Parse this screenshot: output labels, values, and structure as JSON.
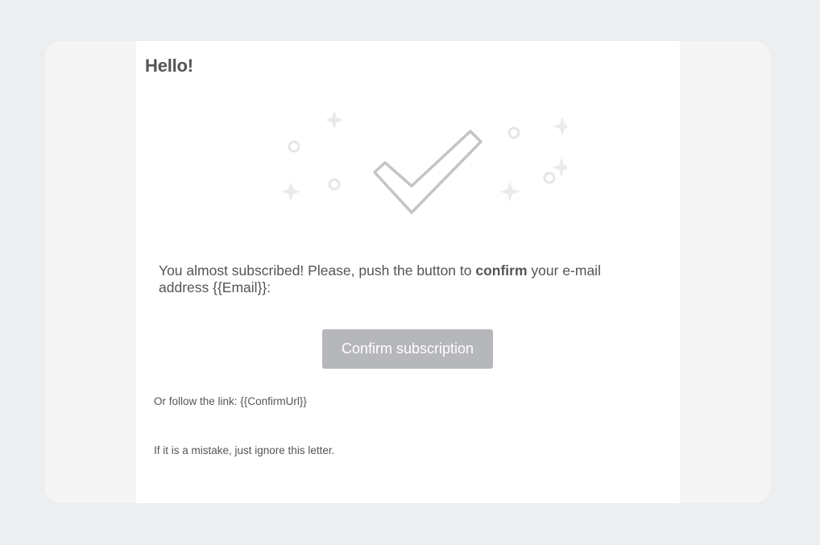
{
  "email": {
    "greeting": "Hello!",
    "message_before": "You almost subscribed! Please, push the button to ",
    "message_bold": "confirm",
    "message_after": " your e-mail address {{Email}}:",
    "confirm_button_label": "Confirm subscription",
    "link_prefix": "Or follow the link: ",
    "link_text": "{{ConfirmUrl}}",
    "ignore_text": "If it is a mistake, just ignore this letter."
  },
  "illustration": {
    "icon": "checkmark-icon",
    "decorations": [
      "sparkle-icon",
      "circle-icon"
    ]
  },
  "colors": {
    "page_background": "#edeef0",
    "frame_background": "#f5f5f5",
    "letter_background": "#ffffff",
    "text": "#555555",
    "button_background": "#b5b7ba",
    "button_text": "#ffffff",
    "illustration_stroke": "#c4c4c4",
    "decoration_fill": "#ebebeb"
  }
}
